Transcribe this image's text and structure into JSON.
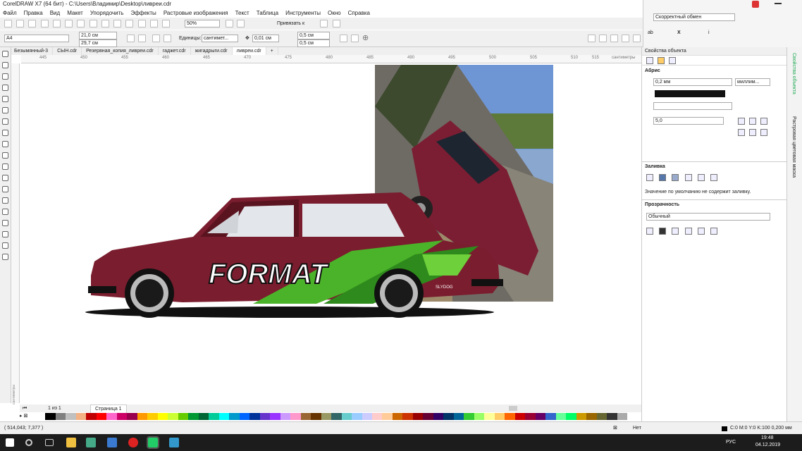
{
  "window": {
    "title": "CorelDRAW X7 (64 бит) - C:\\Users\\Владимир\\Desktop\\ливреи.cdr"
  },
  "menu": [
    "Файл",
    "Правка",
    "Вид",
    "Макет",
    "Упорядочить",
    "Эффекты",
    "Растровые изображения",
    "Текст",
    "Таблица",
    "Инструменты",
    "Окно",
    "Справка"
  ],
  "top_right": {
    "dropdown": "Скорректный обмен",
    "small_labels": [
      "ab",
      "X",
      "i"
    ]
  },
  "toolbar": {
    "zoom": "50%",
    "snap_label": "Привязать к"
  },
  "propbar": {
    "page_size": "A4",
    "width": "21,0 см",
    "height": "29,7 см",
    "units_label": "Единицы:",
    "units_value": "сантимет...",
    "nudge": "0,01 см",
    "dup_x": "0,5 см",
    "dup_y": "0,5 см"
  },
  "tabs": [
    "Безымянный-3",
    "СЫН.cdr",
    "Резервная_копия_ливреи.cdr",
    "гаджет.cdr",
    "жигадрыги.cdr",
    "ливреи.cdr"
  ],
  "ruler": {
    "ticks": [
      "445",
      "450",
      "455",
      "460",
      "465",
      "470",
      "475",
      "480",
      "485",
      "490",
      "495",
      "500",
      "505",
      "510",
      "515"
    ],
    "unit": "сантиметры",
    "v_unit": "сантиметры"
  },
  "artwork": {
    "livery_text": "FORMAT",
    "badge_text": "SLYDOG"
  },
  "panel": {
    "title": "Свойства объекта",
    "outline": {
      "header": "Абрис",
      "width": "0,2 мм",
      "units": "миллим...",
      "miter": "5,0"
    },
    "fill": {
      "header": "Заливка",
      "note": "Значение по умолчанию не содержит заливку."
    },
    "transparency": {
      "header": "Прозрачность",
      "mode": "Обычный"
    }
  },
  "sidestrip": {
    "tab1": "Свойства объекта",
    "tab2": "Растровая цветовая маска"
  },
  "pagebar": {
    "page_count": "1 из 1",
    "page_tab": "Страница 1"
  },
  "status": {
    "coords": "( 514,043; 7,377 )",
    "fill_none": "Нет",
    "outline_info": "C:0 M:0 Y:0 K:100  0,200 мм"
  },
  "taskbar": {
    "lang": "РУС",
    "time": "19:48",
    "date": "04.12.2019"
  },
  "palette": [
    "#ffffff",
    "#000000",
    "#808080",
    "#c0c0c0",
    "#f4b183",
    "#c00000",
    "#ff0000",
    "#ff66cc",
    "#cc0066",
    "#99004d",
    "#ff9900",
    "#ffcc00",
    "#ffff00",
    "#ccff33",
    "#66cc00",
    "#009933",
    "#006633",
    "#00cc99",
    "#00ffff",
    "#0099cc",
    "#0066ff",
    "#003399",
    "#6633cc",
    "#9933ff",
    "#cc99ff",
    "#ff99cc",
    "#996633",
    "#663300",
    "#999966",
    "#336666",
    "#66cccc",
    "#99ccff",
    "#ccccff",
    "#ffcccc",
    "#ffcc99",
    "#cc6600",
    "#cc3300",
    "#990000",
    "#660033",
    "#330066",
    "#003366",
    "#006699",
    "#33cc33",
    "#99ff66",
    "#ffff99",
    "#ffcc66",
    "#ff6600",
    "#cc0000",
    "#990033",
    "#660066",
    "#3366cc",
    "#66ff99",
    "#00ff66",
    "#cc9900",
    "#996600",
    "#666633",
    "#333333",
    "#aaaaaa"
  ]
}
